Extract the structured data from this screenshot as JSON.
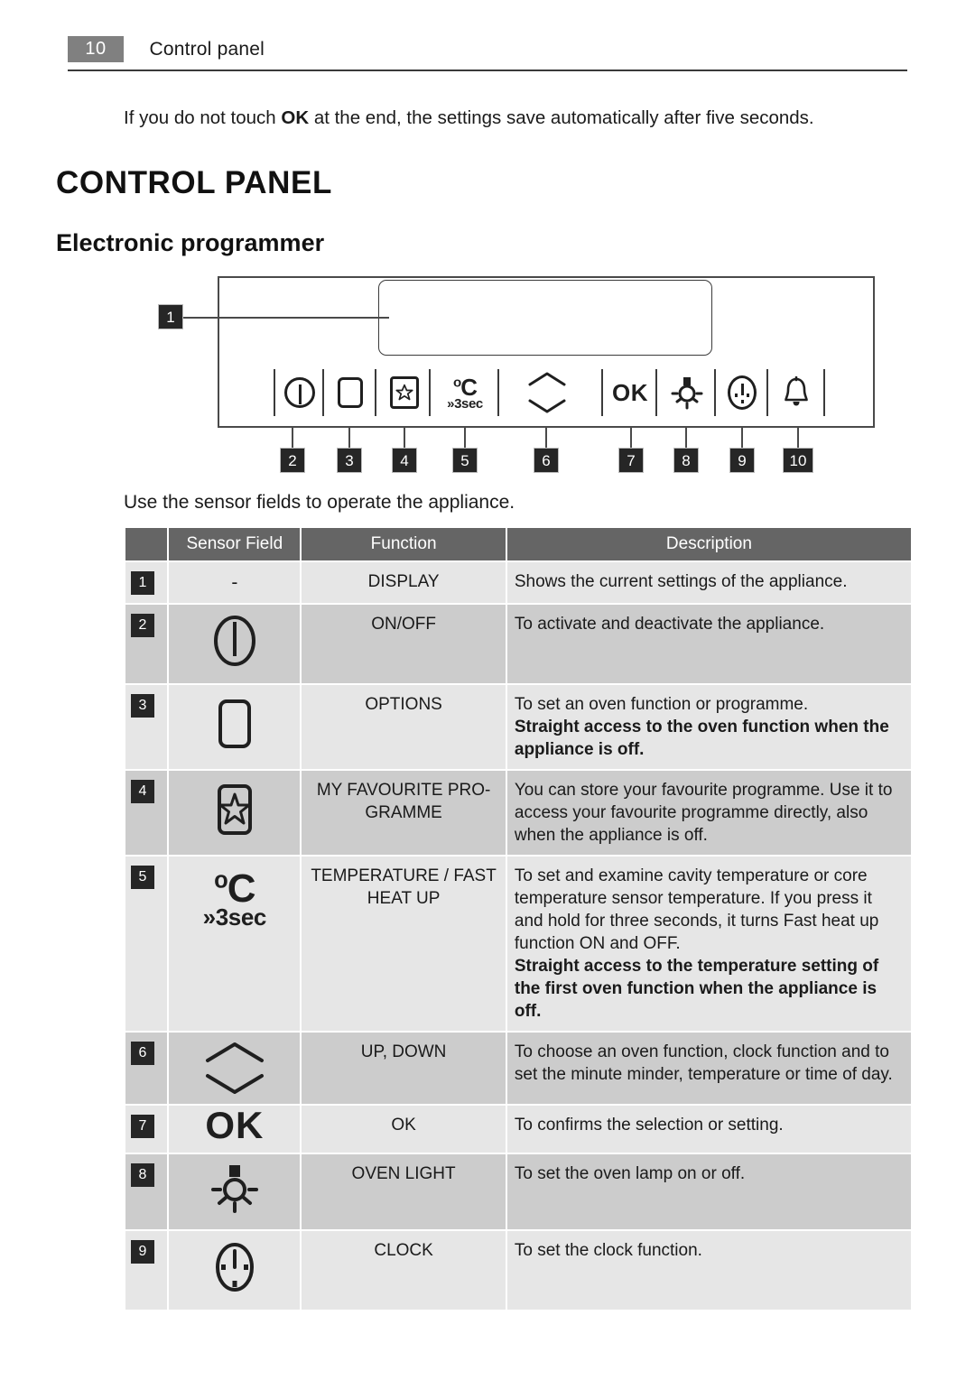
{
  "header": {
    "page_number": "10",
    "title": "Control panel"
  },
  "intro": {
    "before": "If you do not touch ",
    "emphasis": "OK",
    "after": " at the end, the settings save automatically after five seconds."
  },
  "headings": {
    "h1": "CONTROL PANEL",
    "h2": "Electronic programmer"
  },
  "diagram": {
    "callouts": [
      "1",
      "2",
      "3",
      "4",
      "5",
      "6",
      "7",
      "8",
      "9",
      "10"
    ],
    "icons": [
      {
        "ref": "2",
        "name": "power-icon"
      },
      {
        "ref": "3",
        "name": "rounded-square-icon"
      },
      {
        "ref": "4",
        "name": "star-in-box-icon"
      },
      {
        "ref": "5",
        "name": "temperature-3sec-icon",
        "degree": "°C",
        "hold": "3sec"
      },
      {
        "ref": "6",
        "name": "up-down-chevrons-icon"
      },
      {
        "ref": "7",
        "name": "ok-icon",
        "label": "OK"
      },
      {
        "ref": "8",
        "name": "oven-lamp-icon"
      },
      {
        "ref": "9",
        "name": "clock-icon"
      },
      {
        "ref": "10",
        "name": "bell-icon"
      }
    ]
  },
  "use_note": "Use the sensor fields to operate the appliance.",
  "table": {
    "headers": [
      "",
      "Sensor Field",
      "Function",
      "Description"
    ],
    "rows": [
      {
        "num": "1",
        "icon": "none",
        "icon_text": "-",
        "function": "DISPLAY",
        "description": "Shows the current settings of the appliance.",
        "description_bold": ""
      },
      {
        "num": "2",
        "icon": "power-icon",
        "function": "ON/OFF",
        "description": "To activate and deactivate the appliance.",
        "description_bold": ""
      },
      {
        "num": "3",
        "icon": "rounded-square-icon",
        "function": "OPTIONS",
        "description": "To set an oven function or programme.",
        "description_bold": "Straight access to the oven function when the appliance is off."
      },
      {
        "num": "4",
        "icon": "star-in-box-icon",
        "function": "MY FAVOURITE PRO- GRAMME",
        "description": "You can store your favourite programme. Use it to access your favourite programme directly, also when the appliance is off.",
        "description_bold": ""
      },
      {
        "num": "5",
        "icon": "temperature-3sec-icon",
        "function": "TEMPERATURE / FAST HEAT UP",
        "description": "To set and examine cavity temperature or core temperature sensor temperature. If you press it and hold for three seconds, it turns Fast heat up function ON and OFF.",
        "description_bold": "Straight access to the temperature setting of the first oven function when the appliance is off."
      },
      {
        "num": "6",
        "icon": "up-down-chevrons-icon",
        "function": "UP, DOWN",
        "description": "To choose an oven function, clock function and to set the minute minder, temperature or time of day.",
        "description_bold": ""
      },
      {
        "num": "7",
        "icon": "ok-icon",
        "function": "OK",
        "description": "To confirms the selection or setting.",
        "description_bold": ""
      },
      {
        "num": "8",
        "icon": "oven-lamp-icon",
        "function": "OVEN LIGHT",
        "description": "To set the oven lamp on or off.",
        "description_bold": ""
      },
      {
        "num": "9",
        "icon": "clock-icon",
        "function": "CLOCK",
        "description": "To set the clock function.",
        "description_bold": ""
      }
    ]
  },
  "colors": {
    "header_badge": "#808080",
    "table_header": "#656565",
    "row_light": "#e6e6e6",
    "row_dark": "#cccccc",
    "callout": "#262626"
  }
}
